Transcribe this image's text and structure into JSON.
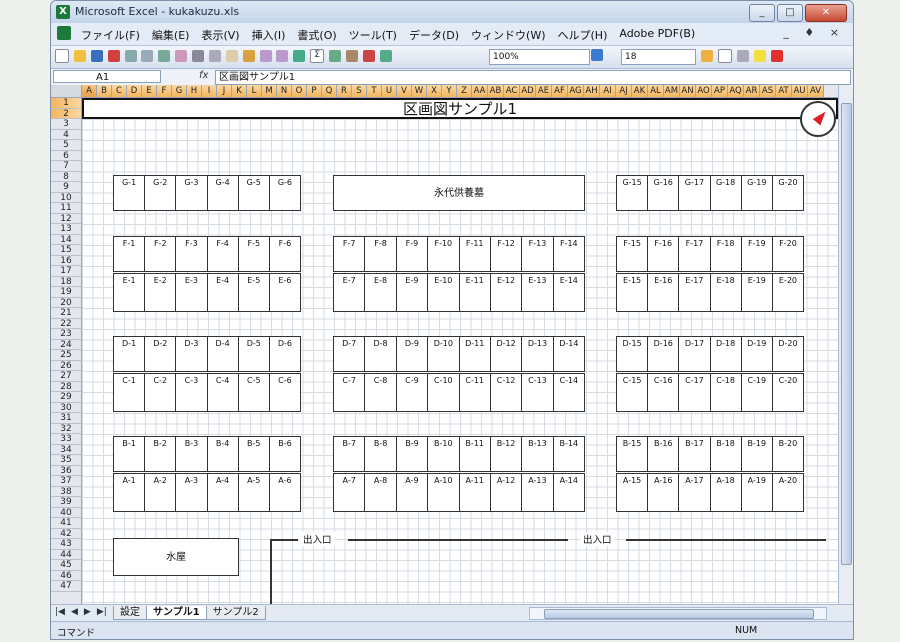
{
  "window": {
    "title": "Microsoft Excel - kukakuzu.xls",
    "controls": [
      "_",
      "□",
      "✕"
    ]
  },
  "menu": {
    "items": [
      "ファイル(F)",
      "編集(E)",
      "表示(V)",
      "挿入(I)",
      "書式(O)",
      "ツール(T)",
      "データ(D)",
      "ウィンドウ(W)",
      "ヘルプ(H)",
      "Adobe PDF(B)"
    ],
    "right": "_ ♦ ×"
  },
  "toolbar": {
    "zoom": "100%",
    "font_size": "18"
  },
  "formula": {
    "cell_ref": "A1",
    "fx": "fx",
    "value": "区画図サンプル1"
  },
  "columns": [
    "A",
    "B",
    "C",
    "D",
    "E",
    "F",
    "G",
    "H",
    "I",
    "J",
    "K",
    "L",
    "M",
    "N",
    "O",
    "P",
    "Q",
    "R",
    "S",
    "T",
    "U",
    "V",
    "W",
    "X",
    "Y",
    "Z",
    "AA",
    "AB",
    "AC",
    "AD",
    "AE",
    "AF",
    "AG",
    "AH",
    "AI",
    "AJ",
    "AK",
    "AL",
    "AM",
    "AN",
    "AO",
    "AP",
    "AQ",
    "AR",
    "AS",
    "AT",
    "AU",
    "AV"
  ],
  "rows": [
    "1",
    "2",
    "3",
    "4",
    "5",
    "6",
    "7",
    "8",
    "9",
    "10",
    "11",
    "12",
    "13",
    "14",
    "15",
    "16",
    "17",
    "18",
    "19",
    "20",
    "21",
    "22",
    "23",
    "24",
    "25",
    "26",
    "27",
    "28",
    "29",
    "30",
    "31",
    "32",
    "33",
    "34",
    "35",
    "36",
    "37",
    "38",
    "39",
    "40",
    "41",
    "42",
    "43",
    "44",
    "45",
    "46",
    "47"
  ],
  "sheet": {
    "title": "区画図サンプル1",
    "g_left": [
      "G-1",
      "G-2",
      "G-3",
      "G-4",
      "G-5",
      "G-6"
    ],
    "g_right": [
      "G-15",
      "G-16",
      "G-17",
      "G-18",
      "G-19",
      "G-20"
    ],
    "eternal": "永代供養墓",
    "f_left": [
      "F-1",
      "F-2",
      "F-3",
      "F-4",
      "F-5",
      "F-6"
    ],
    "f_mid": [
      "F-7",
      "F-8",
      "F-9",
      "F-10",
      "F-11",
      "F-12",
      "F-13",
      "F-14"
    ],
    "f_right": [
      "F-15",
      "F-16",
      "F-17",
      "F-18",
      "F-19",
      "F-20"
    ],
    "e_left": [
      "E-1",
      "E-2",
      "E-3",
      "E-4",
      "E-5",
      "E-6"
    ],
    "e_mid": [
      "E-7",
      "E-8",
      "E-9",
      "E-10",
      "E-11",
      "E-12",
      "E-13",
      "E-14"
    ],
    "e_right": [
      "E-15",
      "E-16",
      "E-17",
      "E-18",
      "E-19",
      "E-20"
    ],
    "d_left": [
      "D-1",
      "D-2",
      "D-3",
      "D-4",
      "D-5",
      "D-6"
    ],
    "d_mid": [
      "D-7",
      "D-8",
      "D-9",
      "D-10",
      "D-11",
      "D-12",
      "D-13",
      "D-14"
    ],
    "d_right": [
      "D-15",
      "D-16",
      "D-17",
      "D-18",
      "D-19",
      "D-20"
    ],
    "c_left": [
      "C-1",
      "C-2",
      "C-3",
      "C-4",
      "C-5",
      "C-6"
    ],
    "c_mid": [
      "C-7",
      "C-8",
      "C-9",
      "C-10",
      "C-11",
      "C-12",
      "C-13",
      "C-14"
    ],
    "c_right": [
      "C-15",
      "C-16",
      "C-17",
      "C-18",
      "C-19",
      "C-20"
    ],
    "b_left": [
      "B-1",
      "B-2",
      "B-3",
      "B-4",
      "B-5",
      "B-6"
    ],
    "b_mid": [
      "B-7",
      "B-8",
      "B-9",
      "B-10",
      "B-11",
      "B-12",
      "B-13",
      "B-14"
    ],
    "b_right": [
      "B-15",
      "B-16",
      "B-17",
      "B-18",
      "B-19",
      "B-20"
    ],
    "a_left": [
      "A-1",
      "A-2",
      "A-3",
      "A-4",
      "A-5",
      "A-6"
    ],
    "a_mid": [
      "A-7",
      "A-8",
      "A-9",
      "A-10",
      "A-11",
      "A-12",
      "A-13",
      "A-14"
    ],
    "a_right": [
      "A-15",
      "A-16",
      "A-17",
      "A-18",
      "A-19",
      "A-20"
    ],
    "water": "水屋",
    "entrance1": "出入口",
    "entrance2": "出入口"
  },
  "tabs": {
    "nav": [
      "|◀",
      "◀",
      "▶",
      "▶|"
    ],
    "sheets": [
      "設定",
      "サンプル1",
      "サンプル2"
    ],
    "active": "サンプル1"
  },
  "status": {
    "left": "コマンド",
    "right": "NUM"
  }
}
